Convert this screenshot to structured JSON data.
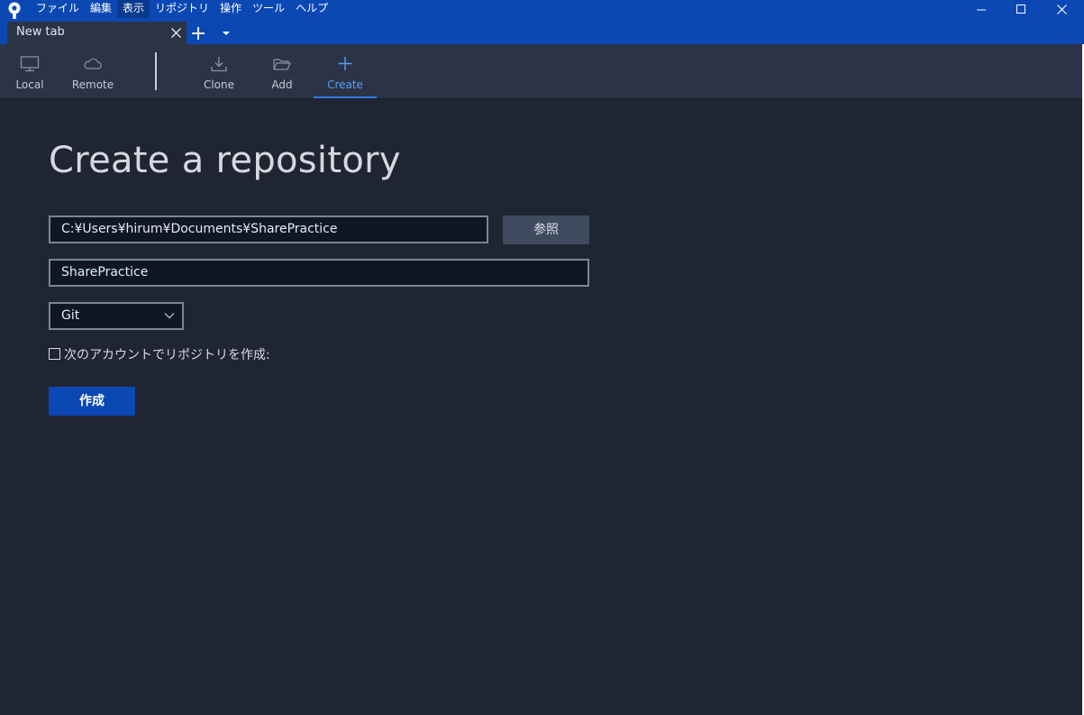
{
  "menu": {
    "items": [
      "ファイル",
      "編集",
      "表示",
      "リポジトリ",
      "操作",
      "ツール",
      "ヘルプ"
    ]
  },
  "window_controls": [
    "minimize-icon",
    "maximize-icon",
    "close-icon"
  ],
  "tab": {
    "label": "New tab"
  },
  "toolbar": {
    "local": "Local",
    "remote": "Remote",
    "clone": "Clone",
    "add": "Add",
    "create": "Create",
    "active": "Create"
  },
  "main": {
    "title": "Create a repository",
    "path_value": "C:¥Users¥hirum¥Documents¥SharePractice",
    "browse_label": "参照",
    "name_value": "SharePractice",
    "vcs_selected": "Git",
    "account_checkbox_label": "次のアカウントでリポジトリを作成:",
    "account_checked": false,
    "create_label": "作成"
  },
  "colors": {
    "accent": "#0b48b3",
    "background": "#1f2533",
    "toolbar": "#2b3447",
    "active_tool": "#5b9cf0"
  }
}
